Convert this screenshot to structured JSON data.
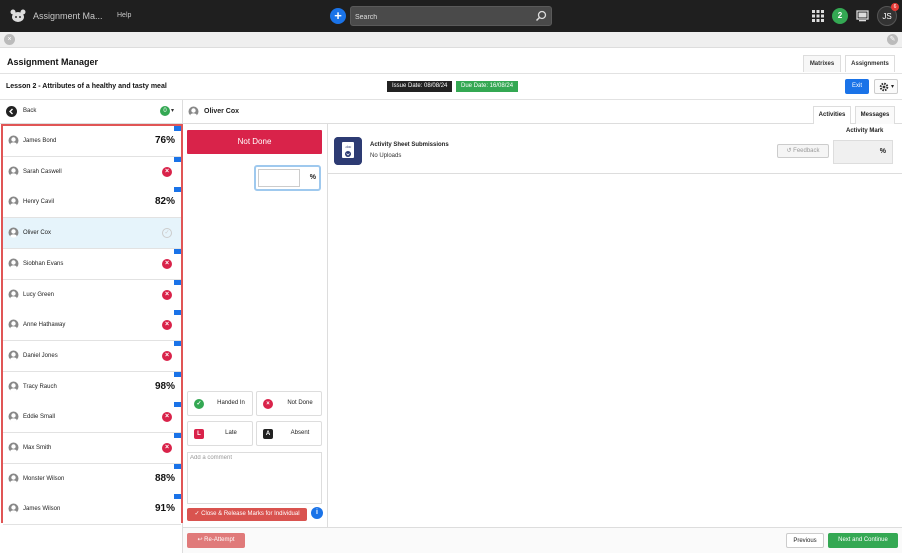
{
  "topbar": {
    "app_title": "Assignment Ma...",
    "help_label": "Help",
    "search_placeholder": "Search",
    "notification_count": "2",
    "avatar_initials": "JS",
    "avatar_badge": "6",
    "icons": [
      "logo-icon",
      "add-icon",
      "search-icon",
      "apps-grid-icon",
      "monitor-icon"
    ]
  },
  "header": {
    "page_title": "Assignment Manager",
    "tabs": [
      "Matrixes",
      "Assignments"
    ]
  },
  "lesson": {
    "title": "Lesson 2 - Attributes of a healthy and tasty meal",
    "issue_date": "Issue Date: 08/08/24",
    "due_date": "Due Date: 16/08/24",
    "exit_label": "Exit"
  },
  "student_list": {
    "back_label": "Back",
    "filter_count": "0",
    "students": [
      {
        "name": "James Bond",
        "score": "76%",
        "status": "score"
      },
      {
        "name": "Sarah Caswell",
        "score": "",
        "status": "not-done"
      },
      {
        "name": "Henry Cavil",
        "score": "82%",
        "status": "score"
      },
      {
        "name": "Oliver Cox",
        "score": "",
        "status": "selected"
      },
      {
        "name": "Siobhan Evans",
        "score": "",
        "status": "not-done"
      },
      {
        "name": "Lucy Green",
        "score": "",
        "status": "not-done"
      },
      {
        "name": "Anne Hathaway",
        "score": "",
        "status": "not-done"
      },
      {
        "name": "Daniel Jones",
        "score": "",
        "status": "not-done"
      },
      {
        "name": "Tracy Rauch",
        "score": "98%",
        "status": "score"
      },
      {
        "name": "Eddie Small",
        "score": "",
        "status": "not-done"
      },
      {
        "name": "Max Smith",
        "score": "",
        "status": "not-done"
      },
      {
        "name": "Monster Wilson",
        "score": "88%",
        "status": "score"
      },
      {
        "name": "James Wilson",
        "score": "91%",
        "status": "score"
      }
    ]
  },
  "student_detail": {
    "name": "Oliver Cox",
    "tabs": [
      "Activities",
      "Messages"
    ],
    "status_banner": "Not Done",
    "mark_value": "",
    "mark_unit": "%",
    "status_buttons": [
      {
        "label": "Handed In",
        "icon": "check-icon",
        "color": "#34a853"
      },
      {
        "label": "Not Done",
        "icon": "cross-icon",
        "color": "#d9234a"
      },
      {
        "label": "Late",
        "icon": "late-icon",
        "color": "#d9234a"
      },
      {
        "label": "Absent",
        "icon": "absent-icon",
        "color": "#222222"
      }
    ],
    "comment_placeholder": "Add a comment",
    "release_label": "Close & Release Marks for Individual"
  },
  "activity": {
    "title": "Activity Sheet Submissions",
    "subtitle": "No Uploads",
    "feedback_label": "Feedback",
    "mark_label": "Activity Mark",
    "mark_unit": "%"
  },
  "footer": {
    "reattempt_label": "Re-Attempt",
    "previous_label": "Previous",
    "next_label": "Next and Continue"
  }
}
